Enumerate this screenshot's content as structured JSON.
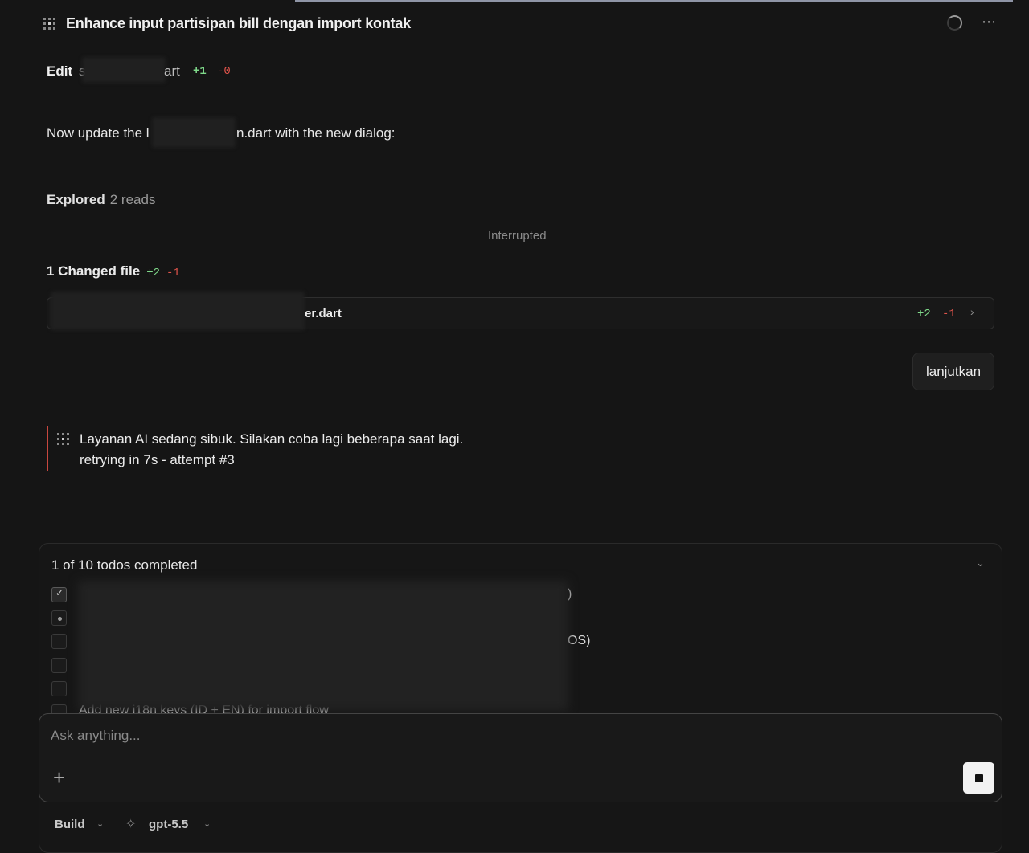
{
  "header": {
    "title": "Enhance input partisipan bill dengan import kontak",
    "more_label": "⋯"
  },
  "edit": {
    "label": "Edit",
    "file_prefix": "s",
    "file_suffix": "art",
    "additions": "+1",
    "deletions": "-0"
  },
  "message": {
    "text_before": "Now update the l",
    "text_after": "n.dart with the new dialog:"
  },
  "explored": {
    "label": "Explored",
    "value": "2 reads"
  },
  "divider": {
    "label": "Interrupted"
  },
  "changed_files": {
    "label": "1 Changed file",
    "additions": "+2",
    "deletions": "-1",
    "file": {
      "name_suffix": "er.dart",
      "additions": "+2",
      "deletions": "-1"
    }
  },
  "user_message": {
    "text": "lanjutkan"
  },
  "error": {
    "line1": "Layanan AI sedang sibuk. Silakan coba lagi beberapa saat lagi.",
    "line2": "retrying in 7s - attempt #3"
  },
  "todos": {
    "summary": "1 of 10 todos completed",
    "items": [
      {
        "status": "completed",
        "text": "",
        "tail": ")"
      },
      {
        "status": "in_progress",
        "text": "",
        "tail": ""
      },
      {
        "status": "pending",
        "text": "",
        "tail": "OS)"
      },
      {
        "status": "pending",
        "text": "",
        "tail": ""
      },
      {
        "status": "pending",
        "text": "",
        "tail": ""
      },
      {
        "status": "pending",
        "text": "Add new i18n keys (ID + EN) for import flow",
        "tail": ""
      }
    ]
  },
  "composer": {
    "placeholder": "Ask anything...",
    "add_label": "+"
  },
  "bottom_bar": {
    "mode": "Build",
    "model": "gpt-5.5"
  },
  "colors": {
    "background": "#151515",
    "additions": "#7fd98a",
    "deletions": "#e0544b",
    "error_accent": "#c8473f"
  }
}
